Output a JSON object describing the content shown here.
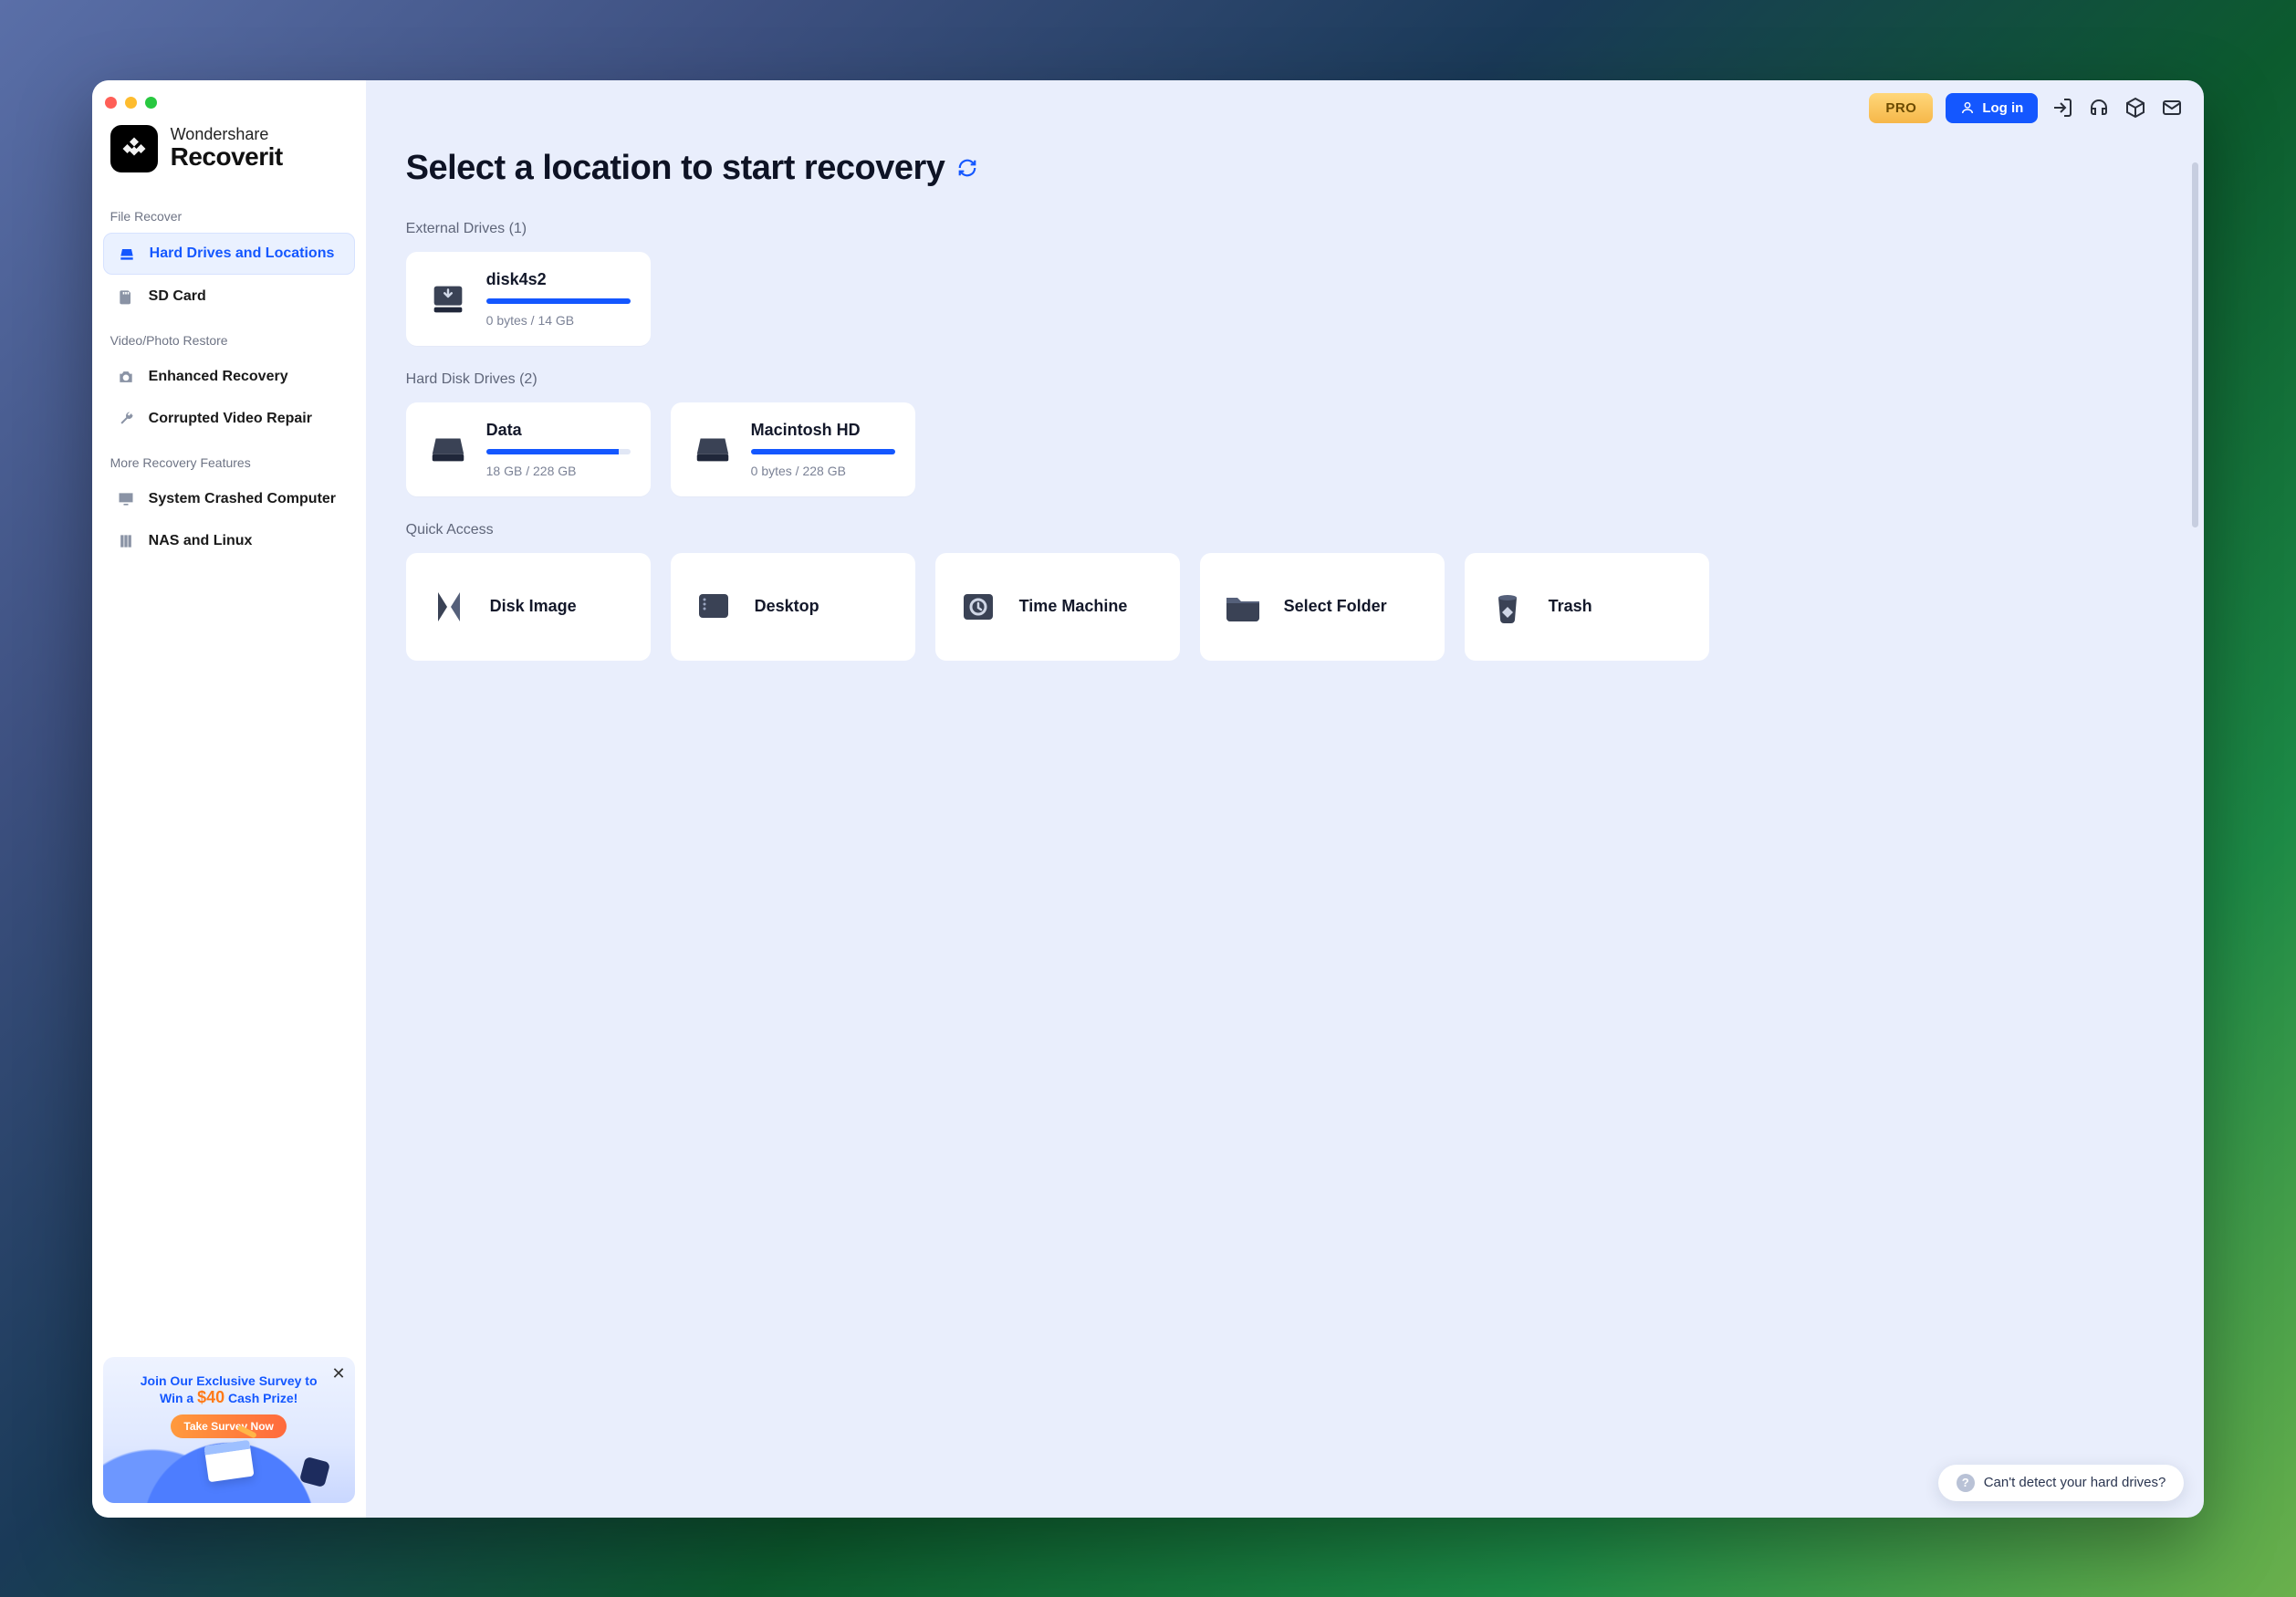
{
  "brand": {
    "top": "Wondershare",
    "bottom": "Recoverit"
  },
  "sidebar": {
    "sections": [
      {
        "title": "File Recover",
        "items": [
          {
            "label": "Hard Drives and Locations",
            "icon": "drive-icon",
            "active": true
          },
          {
            "label": "SD Card",
            "icon": "sdcard-icon",
            "active": false
          }
        ]
      },
      {
        "title": "Video/Photo Restore",
        "items": [
          {
            "label": "Enhanced Recovery",
            "icon": "camera-icon",
            "active": false
          },
          {
            "label": "Corrupted Video Repair",
            "icon": "wrench-icon",
            "active": false
          }
        ]
      },
      {
        "title": "More Recovery Features",
        "items": [
          {
            "label": "System Crashed Computer",
            "icon": "monitor-icon",
            "active": false
          },
          {
            "label": "NAS and Linux",
            "icon": "server-icon",
            "active": false
          }
        ]
      }
    ]
  },
  "promo": {
    "line1": "Join Our Exclusive Survey to",
    "win": "Win a ",
    "price": "$40",
    "line2tail": " Cash Prize!",
    "cta": "Take Survey Now"
  },
  "topbar": {
    "pro": "PRO",
    "login": "Log in"
  },
  "page_title": "Select a location to start recovery",
  "sections": {
    "external": {
      "label": "External Drives (1)"
    },
    "hdd": {
      "label": "Hard Disk Drives (2)"
    },
    "quick": {
      "label": "Quick Access"
    }
  },
  "drives": {
    "external": [
      {
        "name": "disk4s2",
        "sub": "0 bytes / 14 GB",
        "fill": 100
      }
    ],
    "hdd": [
      {
        "name": "Data",
        "sub": "18 GB / 228 GB",
        "fill": 92
      },
      {
        "name": "Macintosh HD",
        "sub": "0 bytes / 228 GB",
        "fill": 100
      }
    ]
  },
  "quick_access": [
    {
      "label": "Disk Image",
      "icon": "diskimage-icon"
    },
    {
      "label": "Desktop",
      "icon": "desktop-icon"
    },
    {
      "label": "Time Machine",
      "icon": "timemachine-icon"
    },
    {
      "label": "Select Folder",
      "icon": "folder-icon"
    },
    {
      "label": "Trash",
      "icon": "trash-icon"
    }
  ],
  "help_pill": "Can't detect your hard drives?"
}
